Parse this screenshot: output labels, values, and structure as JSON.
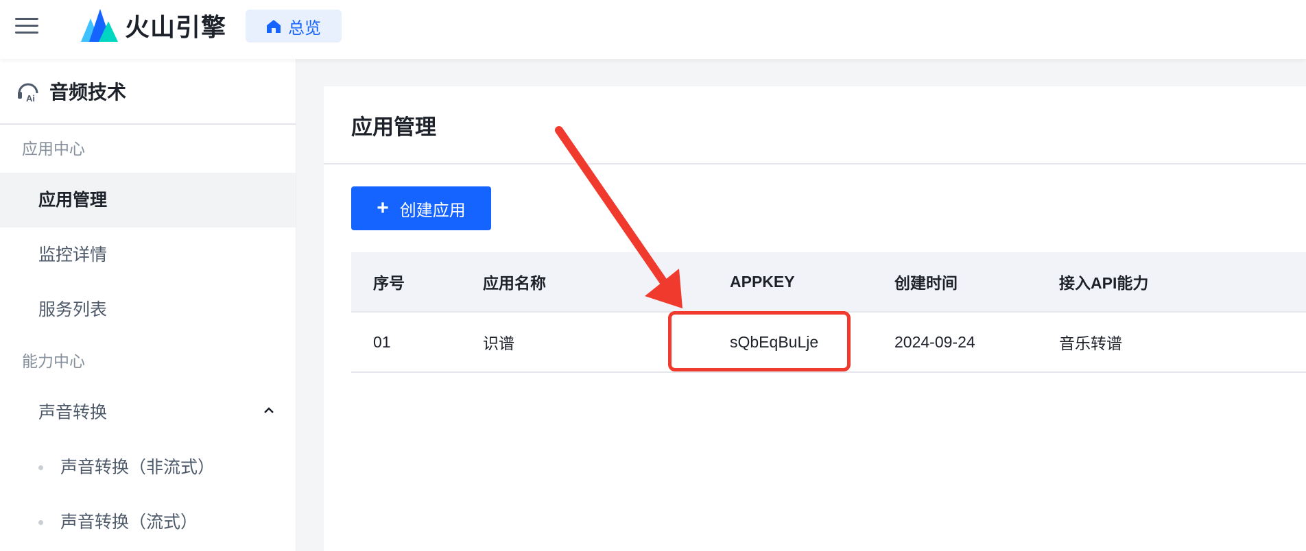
{
  "header": {
    "brand": "火山引擎",
    "overview_label": "总览"
  },
  "sidebar": {
    "title": "音频技术",
    "group_app_center": "应用中心",
    "items_app": [
      {
        "label": "应用管理"
      },
      {
        "label": "监控详情"
      },
      {
        "label": "服务列表"
      }
    ],
    "group_ability_center": "能力中心",
    "ability_item": "声音转换",
    "sub_items": [
      {
        "label": "声音转换（非流式）"
      },
      {
        "label": "声音转换（流式）"
      }
    ]
  },
  "main": {
    "title": "应用管理",
    "create_label": "创建应用",
    "table": {
      "headers": [
        "序号",
        "应用名称",
        "APPKEY",
        "创建时间",
        "接入API能力"
      ],
      "rows": [
        [
          "01",
          "识谱",
          "sQbEqBuLje",
          "2024-09-24",
          "音乐转谱"
        ]
      ]
    }
  },
  "colors": {
    "primary": "#1664ff",
    "annotation_red": "#f03a2e"
  }
}
